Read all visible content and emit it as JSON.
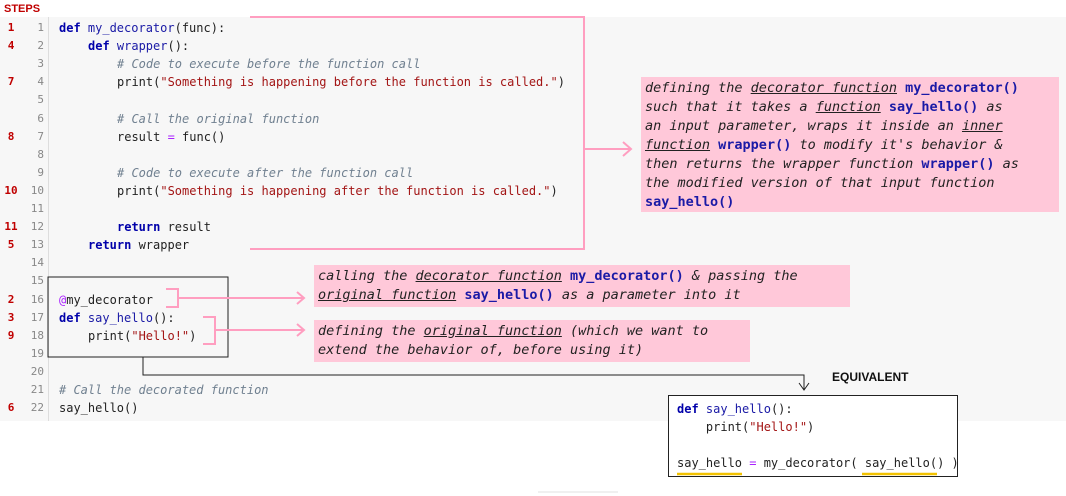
{
  "header": {
    "steps_label": "STEPS"
  },
  "code_lines": [
    {
      "step": "1",
      "num": "1",
      "indent": 0,
      "parts": [
        [
          "kw",
          "def "
        ],
        [
          "fn",
          "my_decorator"
        ],
        [
          "",
          "(func):"
        ]
      ]
    },
    {
      "step": "4",
      "num": "2",
      "indent": 1,
      "parts": [
        [
          "kw",
          "def "
        ],
        [
          "fn",
          "wrapper"
        ],
        [
          "",
          "():"
        ]
      ]
    },
    {
      "step": "",
      "num": "3",
      "indent": 2,
      "parts": [
        [
          "cmt",
          "# Code to execute before the function call"
        ]
      ]
    },
    {
      "step": "7",
      "num": "4",
      "indent": 2,
      "parts": [
        [
          "",
          "print("
        ],
        [
          "str",
          "\"Something is happening before the function is called.\""
        ],
        [
          "",
          ")"
        ]
      ]
    },
    {
      "step": "",
      "num": "5",
      "indent": 0,
      "parts": []
    },
    {
      "step": "",
      "num": "6",
      "indent": 2,
      "parts": [
        [
          "cmt",
          "# Call the original function"
        ]
      ]
    },
    {
      "step": "8",
      "num": "7",
      "indent": 2,
      "parts": [
        [
          "",
          "result "
        ],
        [
          "op",
          "="
        ],
        [
          "",
          " func()"
        ]
      ]
    },
    {
      "step": "",
      "num": "8",
      "indent": 0,
      "parts": []
    },
    {
      "step": "",
      "num": "9",
      "indent": 2,
      "parts": [
        [
          "cmt",
          "# Code to execute after the function call"
        ]
      ]
    },
    {
      "step": "10",
      "num": "10",
      "indent": 2,
      "parts": [
        [
          "",
          "print("
        ],
        [
          "str",
          "\"Something is happening after the function is called.\""
        ],
        [
          "",
          ")"
        ]
      ]
    },
    {
      "step": "",
      "num": "11",
      "indent": 0,
      "parts": []
    },
    {
      "step": "11",
      "num": "12",
      "indent": 2,
      "parts": [
        [
          "kw",
          "return "
        ],
        [
          "",
          "result"
        ]
      ]
    },
    {
      "step": "5",
      "num": "13",
      "indent": 1,
      "parts": [
        [
          "kw",
          "return "
        ],
        [
          "",
          "wrapper"
        ]
      ]
    },
    {
      "step": "",
      "num": "14",
      "indent": 0,
      "parts": []
    },
    {
      "step": "",
      "num": "15",
      "indent": 0,
      "parts": []
    },
    {
      "step": "2",
      "num": "16",
      "indent": 0,
      "parts": [
        [
          "deco",
          "@"
        ],
        [
          "",
          "my_decorator"
        ]
      ]
    },
    {
      "step": "3",
      "num": "17",
      "indent": 0,
      "parts": [
        [
          "kw",
          "def "
        ],
        [
          "fn",
          "say_hello"
        ],
        [
          "",
          "():"
        ]
      ]
    },
    {
      "step": "9",
      "num": "18",
      "indent": 1,
      "parts": [
        [
          "",
          "print("
        ],
        [
          "str",
          "\"Hello!\""
        ],
        [
          "",
          ")"
        ]
      ]
    },
    {
      "step": "",
      "num": "19",
      "indent": 0,
      "parts": []
    },
    {
      "step": "",
      "num": "20",
      "indent": 0,
      "parts": []
    },
    {
      "step": "",
      "num": "21",
      "indent": 0,
      "parts": [
        [
          "cmt",
          "# Call the decorated function"
        ]
      ]
    },
    {
      "step": "6",
      "num": "22",
      "indent": 0,
      "parts": [
        [
          "",
          "say_hello()"
        ]
      ]
    }
  ],
  "annotations": {
    "decorator_def": [
      [
        [
          "",
          "defining the "
        ],
        [
          "u",
          "decorator function"
        ],
        [
          "",
          " "
        ],
        [
          "c",
          "my_decorator()"
        ]
      ],
      [
        [
          "",
          "such that it takes a "
        ],
        [
          "u",
          "function"
        ],
        [
          "",
          " "
        ],
        [
          "c",
          "say_hello()"
        ],
        [
          "",
          " as"
        ]
      ],
      [
        [
          "",
          "an input parameter, wraps it inside an "
        ],
        [
          "u",
          "inner"
        ]
      ],
      [
        [
          "u",
          "function"
        ],
        [
          "",
          " "
        ],
        [
          "c",
          "wrapper()"
        ],
        [
          "",
          " to modify it's behavior &"
        ]
      ],
      [
        [
          "",
          "then returns the wrapper function "
        ],
        [
          "c",
          "wrapper()"
        ],
        [
          "",
          " as"
        ]
      ],
      [
        [
          "",
          "the modified version of that input function"
        ]
      ],
      [
        [
          "c",
          "say_hello()"
        ]
      ]
    ],
    "calling_decorator": [
      [
        [
          "",
          "calling the "
        ],
        [
          "u",
          "decorator function"
        ],
        [
          "",
          " "
        ],
        [
          "c",
          "my_decorator()"
        ],
        [
          "",
          " & passing the"
        ]
      ],
      [
        [
          "u",
          "original function"
        ],
        [
          "",
          " "
        ],
        [
          "c",
          "say_hello()"
        ],
        [
          "",
          " as a parameter into it"
        ]
      ]
    ],
    "original_def": [
      [
        [
          "",
          "defining the "
        ],
        [
          "u",
          "original function"
        ],
        [
          "",
          " (which we want to"
        ]
      ],
      [
        [
          "",
          "extend the behavior of, before using it)"
        ]
      ]
    ]
  },
  "equivalent": {
    "label": "EQUIVALENT",
    "lines": [
      [
        [
          "kw",
          "def "
        ],
        [
          "fn",
          "say_hello"
        ],
        [
          "",
          "():"
        ]
      ],
      [
        [
          "",
          "    print("
        ],
        [
          "str",
          "\"Hello!\""
        ],
        [
          "",
          ")"
        ]
      ],
      [],
      [
        [
          "",
          "say_hello "
        ],
        [
          "op",
          "="
        ],
        [
          "",
          " my_decorator( say_hello() )"
        ]
      ]
    ]
  },
  "colors": {
    "step_red": "#c00000",
    "annotation_pink": "#ffc8d9",
    "connector_pink": "#ff9ec0",
    "highlight_yellow": "#f2c200"
  }
}
